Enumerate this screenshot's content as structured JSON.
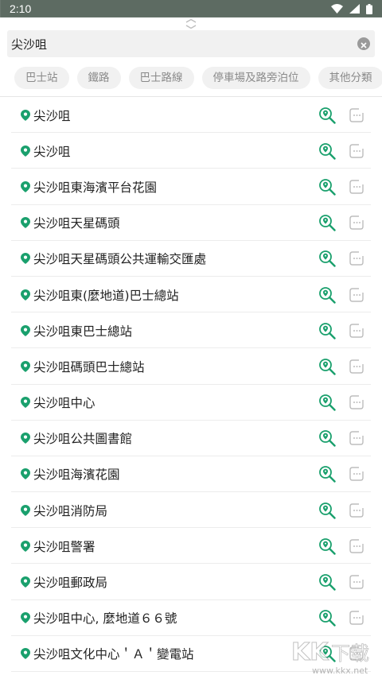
{
  "status_bar": {
    "time": "2:10",
    "icons": [
      "wifi-icon",
      "signal-icon",
      "battery-icon"
    ]
  },
  "search": {
    "value": "尖沙咀"
  },
  "categories": [
    "巴士站",
    "鐵路",
    "巴士路線",
    "停車場及路旁泊位",
    "其他分類"
  ],
  "results": [
    "尖沙咀",
    "尖沙咀",
    "尖沙咀東海濱平台花園",
    "尖沙咀天星碼頭",
    "尖沙咀天星碼頭公共運輸交匯處",
    "尖沙咀東(麼地道)巴士總站",
    "尖沙咀東巴士總站",
    "尖沙咀碼頭巴士總站",
    "尖沙咀中心",
    "尖沙咀公共圖書館",
    "尖沙咀海濱花園",
    "尖沙咀消防局",
    "尖沙咀警署",
    "尖沙咀郵政局",
    "尖沙咀中心, 麼地道６６號",
    "尖沙咀文化中心＇Ａ＇變電站"
  ],
  "colors": {
    "accent": "#1aa06d",
    "chip_bg": "#f1f1f1",
    "chip_text": "#8a8a8a"
  },
  "watermark": {
    "brand": "KK下载",
    "url": "www.kkx.net"
  }
}
